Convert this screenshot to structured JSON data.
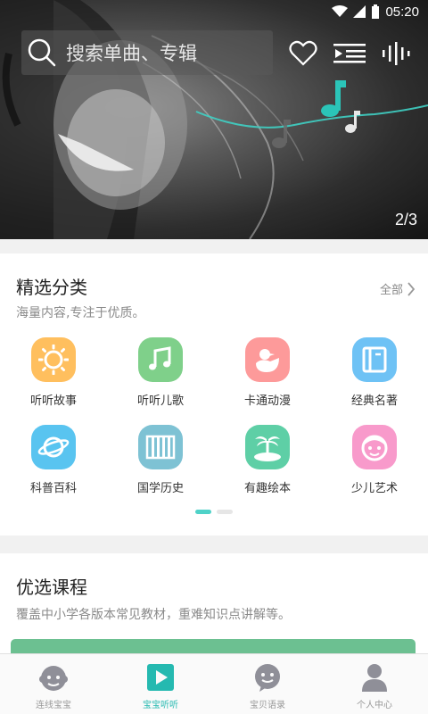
{
  "status_bar": {
    "time": "05:20"
  },
  "hero": {
    "search_placeholder": "搜索单曲、专辑",
    "page_indicator": "2/3",
    "icons": [
      "search-icon",
      "heart-icon",
      "playlist-icon",
      "sound-wave-icon"
    ]
  },
  "categories": {
    "title": "精选分类",
    "subtitle": "海量内容,专注于优质。",
    "all_label": "全部",
    "items": [
      {
        "label": "听听故事",
        "icon": "sun-icon",
        "color": "#ffbf5e"
      },
      {
        "label": "听听儿歌",
        "icon": "music-note-icon",
        "color": "#7fd08a"
      },
      {
        "label": "卡通动漫",
        "icon": "duck-icon",
        "color": "#fd9a9a"
      },
      {
        "label": "经典名著",
        "icon": "book-icon",
        "color": "#6ec2f5"
      },
      {
        "label": "科普百科",
        "icon": "planet-icon",
        "color": "#59c4f0"
      },
      {
        "label": "国学历史",
        "icon": "bamboo-slip-icon",
        "color": "#7ec2d4"
      },
      {
        "label": "有趣绘本",
        "icon": "palm-island-icon",
        "color": "#5ecfa6"
      },
      {
        "label": "少儿艺术",
        "icon": "child-face-icon",
        "color": "#f89acb"
      }
    ]
  },
  "courses": {
    "title": "优选课程",
    "subtitle": "覆盖中小学各版本常见教材，重难知识点讲解等。"
  },
  "bottom_nav": {
    "items": [
      {
        "label": "连线宝宝",
        "icon": "baby-face-icon",
        "active": false
      },
      {
        "label": "宝宝听听",
        "icon": "play-icon",
        "active": true
      },
      {
        "label": "宝贝语录",
        "icon": "chat-face-icon",
        "active": false
      },
      {
        "label": "个人中心",
        "icon": "person-icon",
        "active": false
      }
    ]
  },
  "colors": {
    "accent": "#25b9b0",
    "inactive": "#999999"
  }
}
